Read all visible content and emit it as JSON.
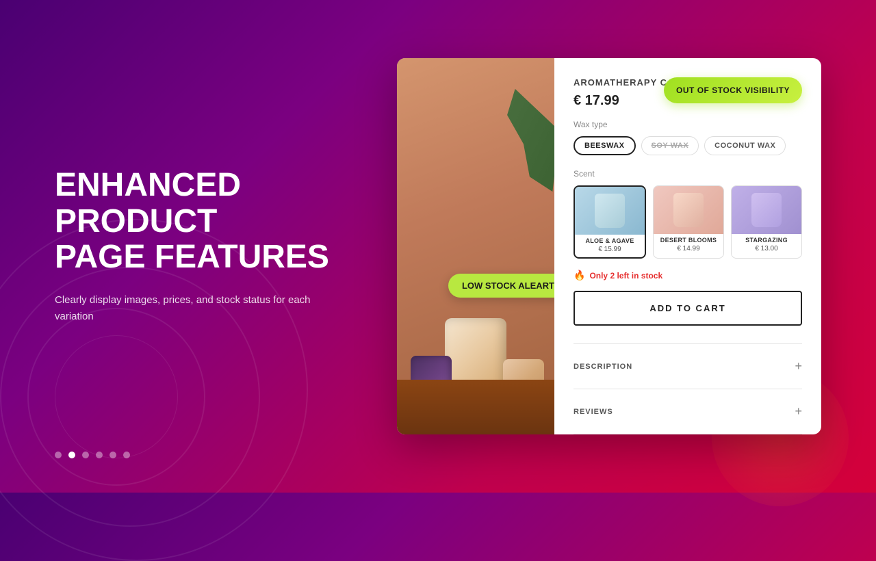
{
  "background": {
    "gradient_start": "#4a0072",
    "gradient_end": "#d4003a"
  },
  "left_panel": {
    "heading_line1": "ENHANCED PRODUCT",
    "heading_line2": "PAGE FEATURES",
    "subtext": "Clearly display images, prices, and stock status for each variation"
  },
  "dots": {
    "count": 6,
    "active_index": 1
  },
  "badge_low_stock": {
    "label": "LOW STOCK ALEART"
  },
  "product": {
    "name": "AROMATHERAPY CANDLE",
    "price": "€ 17.99",
    "oos_badge_label": "OUT OF STOCK VISIBILITY",
    "wax_type_label": "Wax type",
    "wax_options": [
      {
        "label": "BEESWAX",
        "state": "selected"
      },
      {
        "label": "SOY WAX",
        "state": "disabled"
      },
      {
        "label": "COCONUT WAX",
        "state": "normal"
      }
    ],
    "scent_label": "Scent",
    "scent_options": [
      {
        "name": "ALOE & AGAVE",
        "price": "€ 15.99",
        "selected": true
      },
      {
        "name": "DESERT BLOOMS",
        "price": "€ 14.99",
        "selected": false
      },
      {
        "name": "STARGAZING",
        "price": "€ 13.00",
        "selected": false
      }
    ],
    "stock_warning": "Only 2 left in stock",
    "add_to_cart_label": "ADD TO CART",
    "description_label": "DESCRIPTION",
    "reviews_label": "REVIEWS"
  }
}
